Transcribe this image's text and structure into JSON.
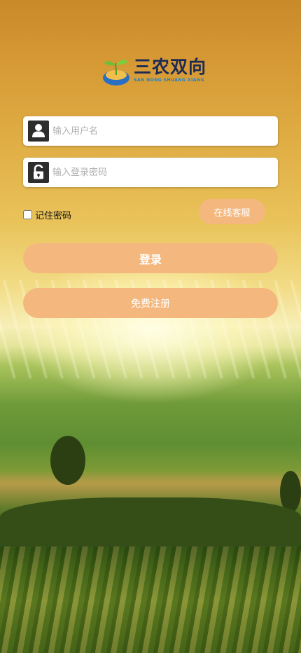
{
  "logo": {
    "title": "三农双向",
    "subtitle": "SAN NONG SHUANG XIANG"
  },
  "form": {
    "username_placeholder": "输入用户名",
    "username_value": "",
    "password_placeholder": "输入登录密码",
    "password_value": "",
    "remember_label": "记住密码",
    "remember_checked": false,
    "service_label": "在线客服",
    "login_label": "登录",
    "register_label": "免费注册"
  },
  "icons": {
    "username": "user-icon",
    "password": "lock-icon",
    "logo": "sprout-hand-logo"
  },
  "colors": {
    "button": "#f4b87f",
    "button_text": "#ffffff",
    "icon_bg": "#2d2d2d",
    "logo_text": "#1d2a55",
    "logo_sub": "#1c7fd0"
  }
}
